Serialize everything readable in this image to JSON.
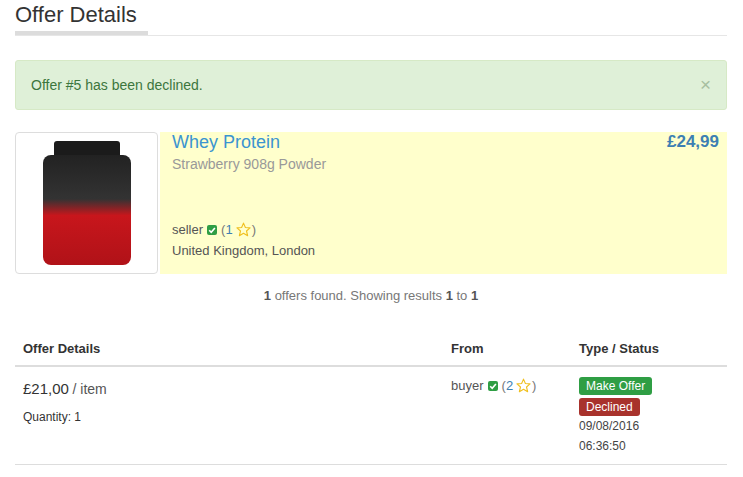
{
  "page": {
    "title": "Offer Details"
  },
  "alert": {
    "message": "Offer #5 has been declined.",
    "close": "×"
  },
  "product": {
    "title": "Whey Protein",
    "subtitle": "Strawberry 908g Powder",
    "price": "£24,99",
    "seller": {
      "name": "seller",
      "verified": true,
      "open": "(",
      "rating": "1",
      "close": ")"
    },
    "location": "United Kingdom, London"
  },
  "results": {
    "count": "1",
    "label": "offers found. Showing results",
    "from": "1",
    "sep": "to",
    "to": "1"
  },
  "table": {
    "columns": [
      "Offer Details",
      "From",
      "Type / Status"
    ],
    "rows": [
      {
        "price": "£21,00",
        "unit": "/ item",
        "quantity": "Quantity: 1",
        "from": {
          "name": "buyer",
          "verified": true,
          "open": "(",
          "rating": "2",
          "close": ")"
        },
        "types": [
          {
            "label": "Make Offer",
            "color": "#2f9e44"
          },
          {
            "label": "Declined",
            "color": "#a8322c"
          }
        ],
        "date": "09/08/2016",
        "time": "06:36:50"
      }
    ]
  }
}
